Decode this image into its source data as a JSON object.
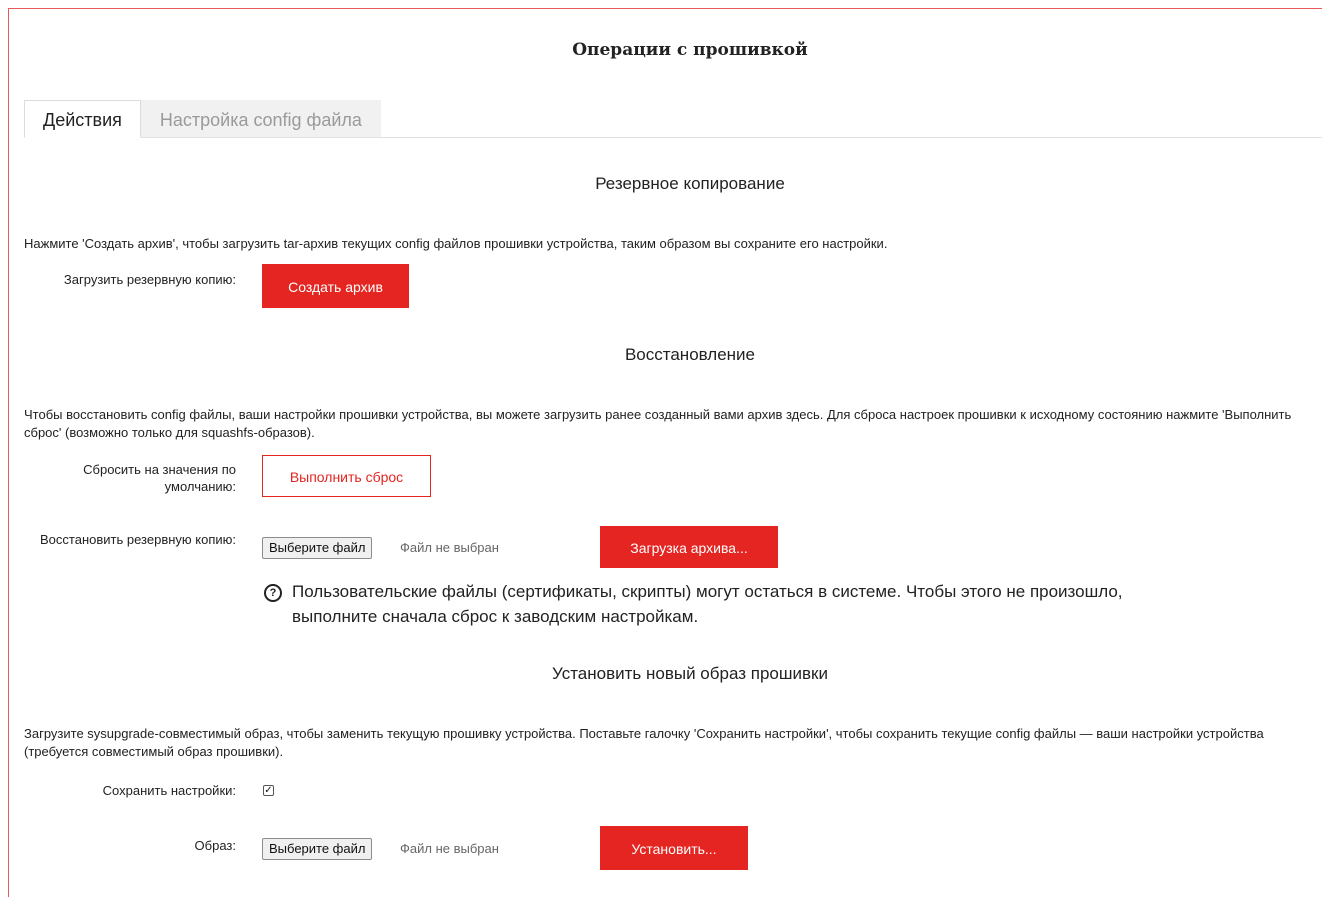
{
  "page": {
    "title": "Операции с прошивкой",
    "accent_color": "#e42521"
  },
  "tabs": [
    {
      "label": "Действия",
      "active": true
    },
    {
      "label": "Настройка config файла",
      "active": false
    }
  ],
  "backup": {
    "title": "Резервное копирование",
    "description": "Нажмите 'Создать архив', чтобы загрузить tar-архив текущих config файлов прошивки устройства, таким образом вы сохраните его настройки.",
    "label": "Загрузить резервную копию:",
    "button": "Создать архив"
  },
  "restore": {
    "title": "Восстановление",
    "description": "Чтобы восстановить config файлы, ваши настройки прошивки устройства, вы можете загрузить ранее созданный вами архив здесь. Для сброса настроек прошивки к исходному состоянию нажмите 'Выполнить сброс' (возможно только для squashfs-образов).",
    "reset_label": "Сбросить на значения по умолчанию:",
    "reset_button": "Выполнить сброс",
    "restore_label": "Восстановить резервную копию:",
    "file_button": "Выберите файл",
    "file_status": "Файл не выбран",
    "upload_button": "Загрузка архива...",
    "hint_icon": "question-circle-icon",
    "hint_line1": "Пользовательские файлы (сертификаты, скрипты) могут остаться в системе. Чтобы этого не произошло,",
    "hint_line2": "выполните сначала сброс к заводским настройкам."
  },
  "upgrade": {
    "title": "Установить новый образ прошивки",
    "description": "Загрузите sysupgrade-совместимый образ, чтобы заменить текущую прошивку устройства. Поставьте галочку 'Сохранить настройки', чтобы сохранить текущие config файлы — ваши настройки устройства (требуется совместимый образ прошивки).",
    "keep_label": "Сохранить настройки:",
    "keep_checked": true,
    "image_label": "Образ:",
    "file_button": "Выберите файл",
    "file_status": "Файл не выбран",
    "install_button": "Установить..."
  }
}
